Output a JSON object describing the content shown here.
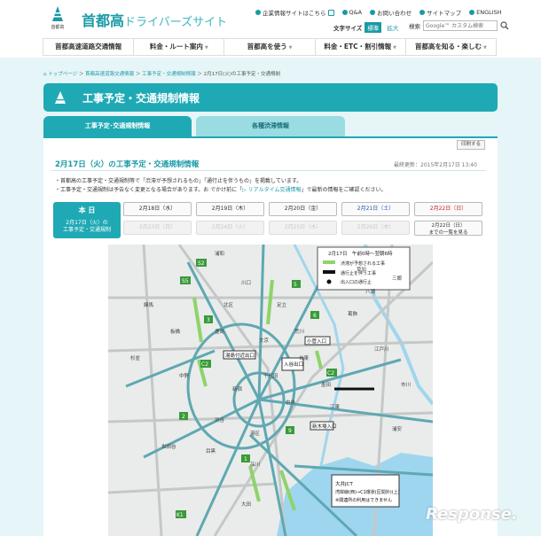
{
  "header": {
    "logo_label": "首都高",
    "site_title_main": "首都高",
    "site_title_sub": "ドライバーズサイト",
    "utility_links": [
      "企業情報サイトはこちら",
      "Q&A",
      "お問い合わせ",
      "サイトマップ",
      "ENGLISH"
    ],
    "font_size_label": "文字サイズ",
    "font_std": "標準",
    "font_large": "拡大",
    "search_label": "検索",
    "search_placeholder": "Google™ カスタム検索"
  },
  "gnav": [
    "首都高速道路交通情報",
    "料金・ルート案内",
    "首都高を使う",
    "料金・ETC・割引情報",
    "首都高を知る・楽しむ"
  ],
  "breadcrumb": [
    "トップページ",
    "首都高速道路交通情報",
    "工事予定・交通規制情報",
    "2月17日(火)の工事予定・交通規制"
  ],
  "page_title": "工事予定・交通規制情報",
  "tabs": [
    "工事予定･交通規制情報",
    "各種渋滞情報"
  ],
  "print_label": "印刷する",
  "content_title": "2月17日（火）の工事予定・交通規制情報",
  "updated": "最終更新：2015年2月17日 13:40",
  "notes": {
    "line1": "・首都高の工事予定・交通規制等で「渋滞が予想されるもの」「通行止を伴うもの」を掲載しています。",
    "line2_a": "・工事予定・交通規制は予告なく変更となる場合があります。お でかけ前に「",
    "line2_link": "▷ リアルタイム交通情報",
    "line2_b": "」で最新の情報をご確認ください。"
  },
  "today": {
    "label": "本 日",
    "date": "2月17日（火）の",
    "caption": "工事予定・交通規制"
  },
  "dates_row1": [
    "2月18日（水）",
    "2月19日（木）",
    "2月20日（金）",
    "2月21日（土）",
    "2月22日（日）"
  ],
  "dates_row2": [
    "2月23日（月）",
    "2月24日（火）",
    "2月25日（水）",
    "2月26日（木）"
  ],
  "all_button": {
    "line1": "2月22日（日）",
    "line2": "までの一覧を見る"
  },
  "map": {
    "legend_title": "2月17日　午前0時〜翌朝6時",
    "legend_items": [
      "渋滞が予想される工事",
      "通行止を伴う工事",
      "出入口の通行止"
    ],
    "callouts": [
      "小菅入口",
      "入谷出口",
      "福住入口",
      "新木場入口",
      "湯島付近出口"
    ],
    "callout_box": [
      "大井JCT",
      "湾岸線(西)→C1環状(区間外)(上)",
      "※関連所の利用はできません"
    ],
    "place_labels": [
      "浦和",
      "川口",
      "足立",
      "葛飾",
      "江戸川",
      "北区",
      "板橋",
      "練馬",
      "中野",
      "新宿",
      "渋谷",
      "港区",
      "品川",
      "大田",
      "江東",
      "墨田",
      "台東",
      "荒川",
      "千代田",
      "中央",
      "世田谷",
      "目黒",
      "杉並",
      "豊島",
      "文京",
      "三郷",
      "八潮",
      "草加",
      "市川",
      "浦安"
    ],
    "route_numbers": [
      "S2",
      "S5",
      "S1",
      "5",
      "3",
      "C2",
      "C1",
      "4",
      "2",
      "1",
      "9",
      "11",
      "7",
      "6",
      "K1",
      "B",
      "S"
    ]
  },
  "watermark": "Response.",
  "colors": {
    "accent": "#1fa9b5",
    "tab_inactive": "#9adce2",
    "page_bg": "#e6f5f7"
  }
}
